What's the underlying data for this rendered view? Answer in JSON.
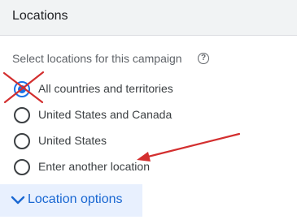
{
  "header": {
    "title": "Locations"
  },
  "subtitle": "Select locations for this campaign",
  "help_icon": "?",
  "options": [
    {
      "label": "All countries and territories",
      "selected": true
    },
    {
      "label": "United States and Canada",
      "selected": false
    },
    {
      "label": "United States",
      "selected": false
    },
    {
      "label": "Enter another location",
      "selected": false
    }
  ],
  "location_options": {
    "label": "Location options",
    "icon": "chevron-down-icon"
  },
  "annotations": {
    "cross_color": "#d32f2f",
    "arrow_color": "#d32f2f"
  },
  "colors": {
    "accent": "#1a73e8",
    "header_bg": "#f1f3f4",
    "button_bg": "#e8f0fe"
  }
}
